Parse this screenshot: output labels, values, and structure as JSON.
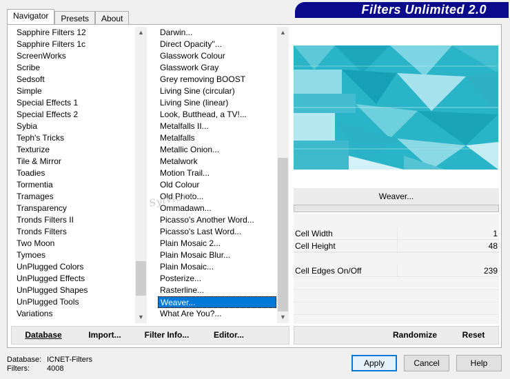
{
  "tabs": [
    "Navigator",
    "Presets",
    "About"
  ],
  "banner_title": "Filters Unlimited 2.0",
  "categories": [
    "Sapphire Filters 12",
    "Sapphire Filters 1c",
    "ScreenWorks",
    "Scribe",
    "Sedsoft",
    "Simple",
    "Special Effects 1",
    "Special Effects 2",
    "Sybia",
    "Teph's Tricks",
    "Texturize",
    "Tile & Mirror",
    "Toadies",
    "Tormentia",
    "Tramages",
    "Transparency",
    "Tronds Filters II",
    "Tronds Filters",
    "Two Moon",
    "Tymoes",
    "UnPlugged Colors",
    "UnPlugged Effects",
    "UnPlugged Shapes",
    "UnPlugged Tools",
    "Variations"
  ],
  "selected_category": "Toadies",
  "filters": [
    "Darwin...",
    "Direct Opacity''...",
    "Glasswork Colour",
    "Glasswork Gray",
    "Grey removing BOOST",
    "Living Sine (circular)",
    "Living Sine (linear)",
    "Look, Butthead, a TV!...",
    "Metalfalls II...",
    "Metalfalls",
    "Metallic Onion...",
    "Metalwork",
    "Motion Trail...",
    "Old Colour",
    "Old Photo...",
    "Ommadawn...",
    "Picasso's Another Word...",
    "Picasso's Last Word...",
    "Plain Mosaic 2...",
    "Plain Mosaic Blur...",
    "Plain Mosaic...",
    "Posterize...",
    "Rasterline...",
    "Weaver...",
    "What Are You?..."
  ],
  "selected_filter": "Weaver...",
  "left_buttons": {
    "database": "Database",
    "import": "Import...",
    "filter_info": "Filter Info...",
    "editor": "Editor..."
  },
  "current_filter_label": "Weaver...",
  "params": [
    {
      "label": "Cell Width",
      "value": "1"
    },
    {
      "label": "Cell Height",
      "value": "48"
    },
    {
      "label": "Cell Edges On/Off",
      "value": "239"
    }
  ],
  "right_buttons": {
    "randomize": "Randomize",
    "reset": "Reset"
  },
  "status": {
    "database_key": "Database:",
    "database_value": "ICNET-Filters",
    "filters_key": "Filters:",
    "filters_value": "4008"
  },
  "dialog_buttons": {
    "apply": "Apply",
    "cancel": "Cancel",
    "help": "Help"
  },
  "watermark": "Sylviane",
  "colors": {
    "accent": "#0078d7",
    "banner": "#0a0a8a",
    "preview": "#26b2c6"
  }
}
